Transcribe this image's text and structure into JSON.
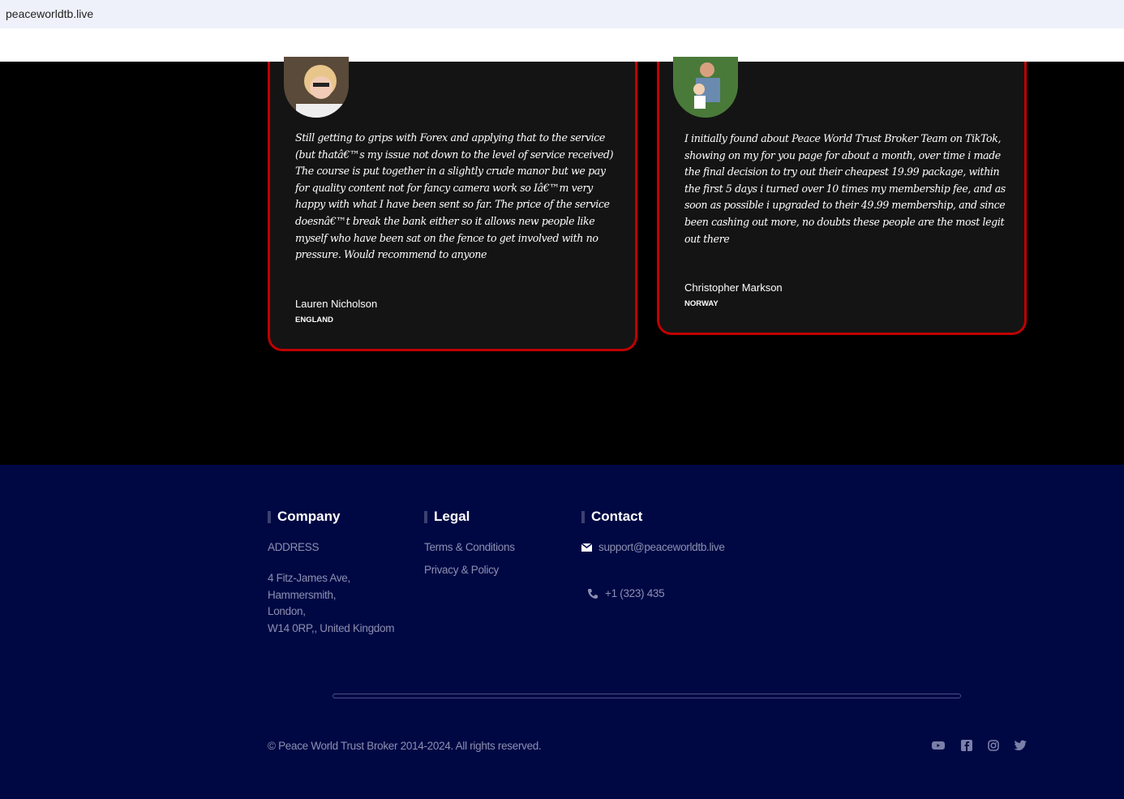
{
  "browser": {
    "url": "peaceworldtb.live"
  },
  "testimonials": [
    {
      "quote": "Still getting to grips with Forex and applying that to the service (but thatâ€™s my issue not down to the level of service received) The course is put together in a slightly crude manor but we pay for quality content not for fancy camera work so Iâ€™m very happy with what I have been sent so far. The price of the service doesnâ€™t break the bank either so it allows new people like myself who have been sat on the fence to get involved with no pressure. Would recommend to anyone",
      "name": "Lauren Nicholson",
      "country": "ENGLAND"
    },
    {
      "quote": "I initially found about Peace World Trust Broker Team on TikTok, showing on my for you page for about a month, over time i made the final decision to try out their cheapest 19.99 package, within the first 5 days i turned over 10 times my membership fee, and as soon as possible i upgraded to their 49.99 membership, and since been cashing out more, no doubts these people are the most legit out there",
      "name": "Christopher Markson",
      "country": "NORWAY"
    }
  ],
  "footer": {
    "company": {
      "title": "Company",
      "address_label": "ADDRESS",
      "address_lines": [
        "4 Fitz-James Ave,",
        "Hammersmith,",
        "London,",
        "W14 0RP,, United Kingdom"
      ]
    },
    "legal": {
      "title": "Legal",
      "links": [
        "Terms & Conditions",
        "Privacy & Policy"
      ]
    },
    "contact": {
      "title": "Contact",
      "email": "support@peaceworldtb.live",
      "phone": "+1 (323) 435"
    },
    "copyright": "© Peace World Trust Broker 2014-2024. All rights reserved.",
    "social": [
      "youtube-icon",
      "facebook-icon",
      "instagram-icon",
      "twitter-icon"
    ]
  },
  "colors": {
    "card_border": "#c00000",
    "footer_bg": "#000844"
  }
}
